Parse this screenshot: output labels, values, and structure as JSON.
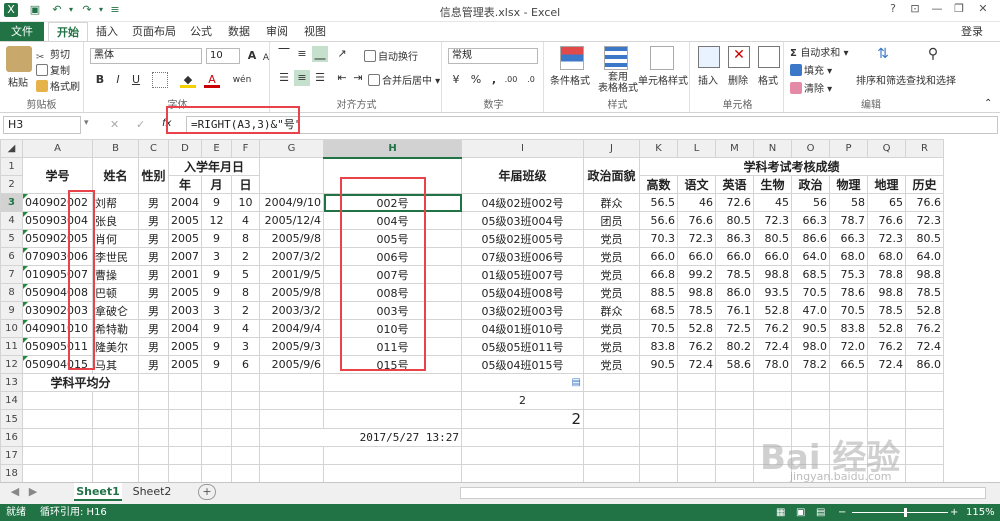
{
  "window": {
    "title": "信息管理表.xlsx - Excel",
    "login": "登录"
  },
  "tabs": [
    "文件",
    "开始",
    "插入",
    "页面布局",
    "公式",
    "数据",
    "审阅",
    "视图"
  ],
  "ribbon": {
    "clipboard": {
      "paste": "粘贴",
      "cut": "剪切",
      "copy": "复制",
      "format_painter": "格式刷",
      "label": "剪贴板"
    },
    "font": {
      "name": "黑体",
      "size": "10",
      "label": "字体",
      "bold": "B",
      "italic": "I",
      "underline": "U",
      "grow": "A",
      "shrink": "A",
      "wen": "wén"
    },
    "alignment": {
      "wrap": "自动换行",
      "merge": "合并后居中",
      "label": "对齐方式"
    },
    "number": {
      "format": "常规",
      "label": "数字",
      "pct": "%",
      "comma": ",",
      "dec_inc": ".00",
      "dec_dec": ".0"
    },
    "styles": {
      "conditional": "条件格式",
      "table": "套用\n表格格式",
      "cell": "单元格样式",
      "label": "样式"
    },
    "cells": {
      "insert": "插入",
      "delete": "删除",
      "format": "格式",
      "label": "单元格"
    },
    "editing": {
      "autosum": "自动求和",
      "fill": "填充",
      "clear": "清除",
      "sort": "排序和筛选",
      "find": "查找和选择",
      "label": "编辑"
    }
  },
  "formula_bar": {
    "cell_ref": "H3",
    "fx": "fx",
    "cancel": "✕",
    "enter": "✓",
    "formula": "=RIGHT(A3,3)&\"号\""
  },
  "columns": [
    "A",
    "B",
    "C",
    "D",
    "E",
    "F",
    "G",
    "H",
    "I",
    "J",
    "K",
    "L",
    "M",
    "N",
    "O",
    "P",
    "Q",
    "R"
  ],
  "headers": {
    "xuehao": "学号",
    "xingming": "姓名",
    "xingbie": "性别",
    "ruxue": "入学年月日",
    "nian": "年",
    "yue": "月",
    "ri": "日",
    "banji": "年届班级",
    "zhengzhi": "政治面貌",
    "chengji": "学科考试考核成绩",
    "subjects": [
      "高数",
      "语文",
      "英语",
      "生物",
      "政治",
      "物理",
      "地理",
      "历史"
    ]
  },
  "rows": [
    {
      "id": "040902002",
      "name": "刘帮",
      "sex": "男",
      "y": "2004",
      "m": "9",
      "d": "10",
      "date": "2004/9/10",
      "h": "002号",
      "cls": "04级02班002号",
      "pol": "群众",
      "s": [
        "56.5",
        "46",
        "72.6",
        "45",
        "56",
        "58",
        "65",
        "76.6"
      ]
    },
    {
      "id": "050903004",
      "name": "张良",
      "sex": "男",
      "y": "2005",
      "m": "12",
      "d": "4",
      "date": "2005/12/4",
      "h": "004号",
      "cls": "05级03班004号",
      "pol": "团员",
      "s": [
        "56.6",
        "76.6",
        "80.5",
        "72.3",
        "66.3",
        "78.7",
        "76.6",
        "72.3"
      ]
    },
    {
      "id": "050902005",
      "name": "肖何",
      "sex": "男",
      "y": "2005",
      "m": "9",
      "d": "8",
      "date": "2005/9/8",
      "h": "005号",
      "cls": "05级02班005号",
      "pol": "党员",
      "s": [
        "70.3",
        "72.3",
        "86.3",
        "80.5",
        "86.6",
        "66.3",
        "72.3",
        "80.5"
      ]
    },
    {
      "id": "070903006",
      "name": "李世民",
      "sex": "男",
      "y": "2007",
      "m": "3",
      "d": "2",
      "date": "2007/3/2",
      "h": "006号",
      "cls": "07级03班006号",
      "pol": "党员",
      "s": [
        "66.0",
        "66.0",
        "66.0",
        "66.0",
        "64.0",
        "68.0",
        "68.0",
        "64.0"
      ]
    },
    {
      "id": "010905007",
      "name": "曹操",
      "sex": "男",
      "y": "2001",
      "m": "9",
      "d": "5",
      "date": "2001/9/5",
      "h": "007号",
      "cls": "01级05班007号",
      "pol": "党员",
      "s": [
        "66.8",
        "99.2",
        "78.5",
        "98.8",
        "68.5",
        "75.3",
        "78.8",
        "98.8"
      ]
    },
    {
      "id": "050904008",
      "name": "巴顿",
      "sex": "男",
      "y": "2005",
      "m": "9",
      "d": "8",
      "date": "2005/9/8",
      "h": "008号",
      "cls": "05级04班008号",
      "pol": "党员",
      "s": [
        "88.5",
        "98.8",
        "86.0",
        "93.5",
        "70.5",
        "78.6",
        "98.8",
        "78.5"
      ]
    },
    {
      "id": "030902003",
      "name": "拿破仑",
      "sex": "男",
      "y": "2003",
      "m": "3",
      "d": "2",
      "date": "2003/3/2",
      "h": "003号",
      "cls": "03级02班003号",
      "pol": "群众",
      "s": [
        "68.5",
        "78.5",
        "76.1",
        "52.8",
        "47.0",
        "70.5",
        "78.5",
        "52.8"
      ]
    },
    {
      "id": "040901010",
      "name": "希特勒",
      "sex": "男",
      "y": "2004",
      "m": "9",
      "d": "4",
      "date": "2004/9/4",
      "h": "010号",
      "cls": "04级01班010号",
      "pol": "党员",
      "s": [
        "70.5",
        "52.8",
        "72.5",
        "76.2",
        "90.5",
        "83.8",
        "52.8",
        "76.2"
      ]
    },
    {
      "id": "050905011",
      "name": "隆美尔",
      "sex": "男",
      "y": "2005",
      "m": "9",
      "d": "3",
      "date": "2005/9/3",
      "h": "011号",
      "cls": "05级05班011号",
      "pol": "党员",
      "s": [
        "83.8",
        "76.2",
        "80.2",
        "72.4",
        "98.0",
        "72.0",
        "76.2",
        "72.4"
      ]
    },
    {
      "id": "050904015",
      "name": "马其",
      "sex": "男",
      "y": "2005",
      "m": "9",
      "d": "6",
      "date": "2005/9/6",
      "h": "015号",
      "cls": "05级04班015号",
      "pol": "党员",
      "s": [
        "90.5",
        "72.4",
        "58.6",
        "78.0",
        "78.2",
        "66.5",
        "72.4",
        "86.0"
      ]
    }
  ],
  "row13_label": "学科平均分",
  "row14_i": "2",
  "row15_i": "2",
  "row16_g": "2017/5/27 13:27",
  "row_numbers": [
    "1",
    "2",
    "3",
    "4",
    "5",
    "6",
    "7",
    "8",
    "9",
    "10",
    "11",
    "12",
    "13",
    "14",
    "15",
    "16",
    "17",
    "18"
  ],
  "sheets": [
    "Sheet1",
    "Sheet2"
  ],
  "add_sheet": "+",
  "status": {
    "ready": "就绪",
    "circular": "循环引用: H16",
    "zoom": "115%",
    "minus": "−",
    "plus": "+"
  },
  "watermark": {
    "text": "Bai 经验",
    "url": "jingyan.baidu.com"
  },
  "colors": {
    "excel_green": "#217346",
    "highlight_red": "#e8434b"
  }
}
